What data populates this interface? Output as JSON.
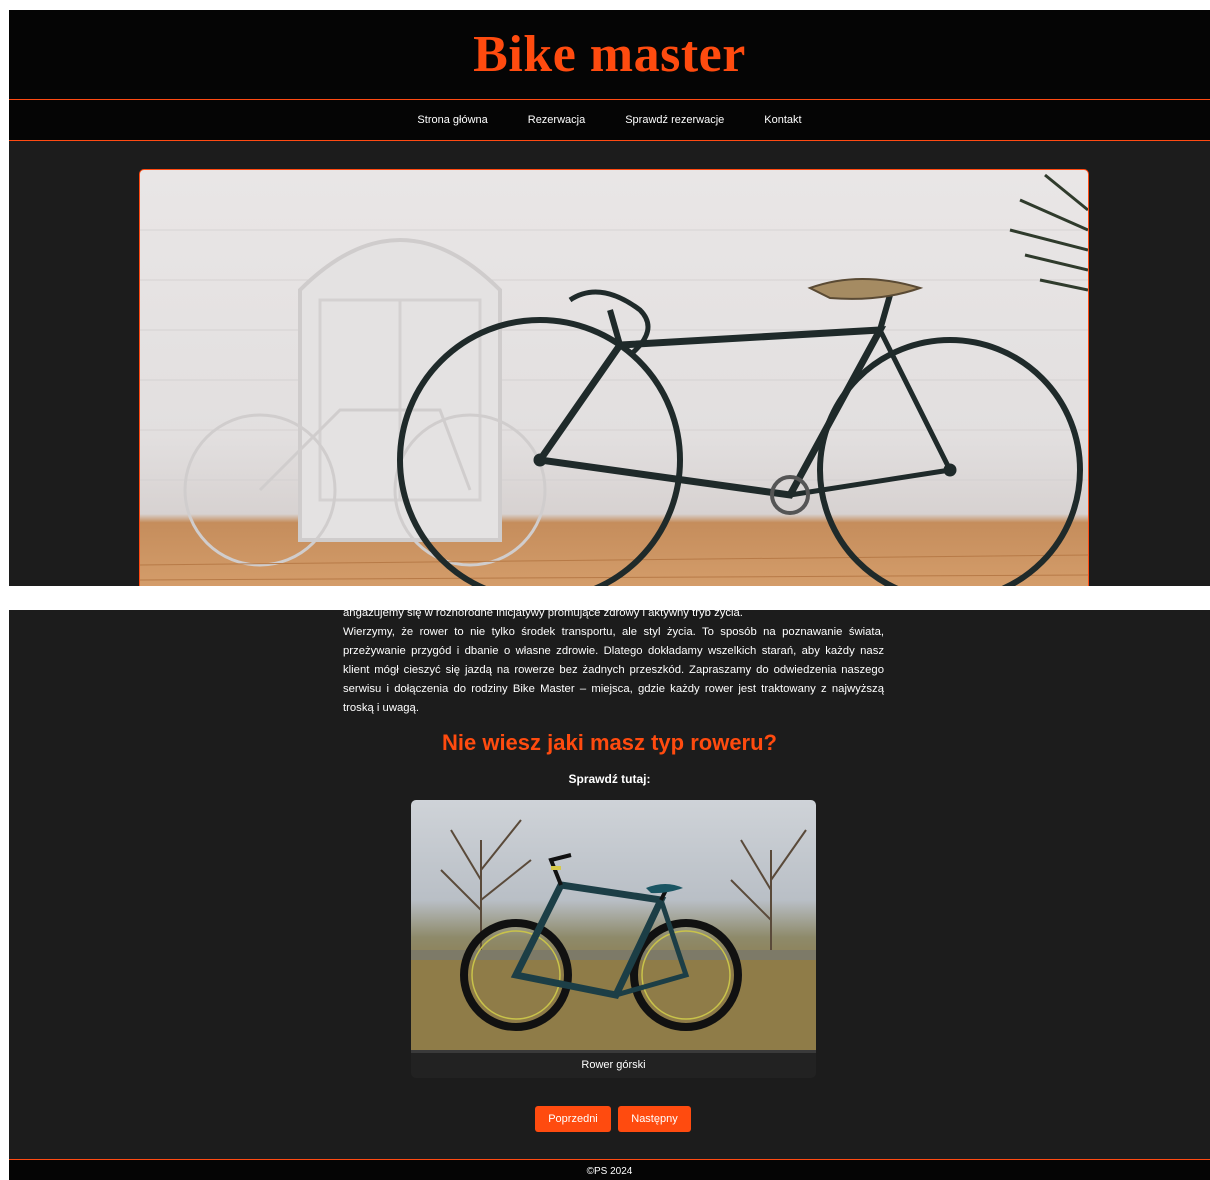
{
  "site": {
    "title": "Bike master"
  },
  "nav": {
    "items": [
      {
        "label": "Strona główna"
      },
      {
        "label": "Rezerwacja"
      },
      {
        "label": "Sprawdź rezerwacje"
      },
      {
        "label": "Kontakt"
      }
    ]
  },
  "about": {
    "line1": "angażujemy się w różnorodne inicjatywy promujące zdrowy i aktywny tryb życia.",
    "paragraph": "Wierzymy, że rower to nie tylko środek transportu, ale styl życia. To sposób na poznawanie świata, przeżywanie przygód i dbanie o własne zdrowie. Dlatego dokładamy wszelkich starań, aby każdy nasz klient mógł cieszyć się jazdą na rowerze bez żadnych przeszkód. Zapraszamy do odwiedzenia naszego serwisu i dołączenia do rodziny Bike Master – miejsca, gdzie każdy rower jest traktowany z najwyższą troską i uwagą."
  },
  "bike_type": {
    "heading": "Nie wiesz jaki masz typ roweru?",
    "subheading": "Sprawdź tutaj:",
    "caption": "Rower górski",
    "prev_label": "Poprzedni",
    "next_label": "Następny"
  },
  "footer": {
    "text": "©PS 2024"
  },
  "colors": {
    "accent": "#ff4b0f",
    "background": "#1c1c1c",
    "header": "#050505"
  }
}
